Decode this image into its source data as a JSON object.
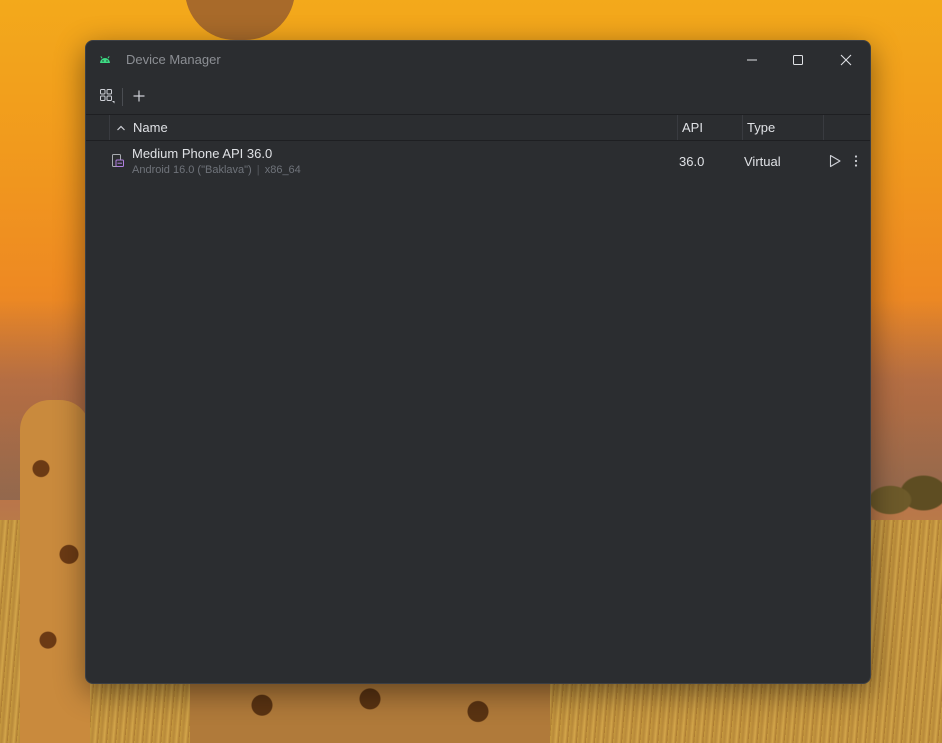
{
  "window": {
    "title": "Device Manager"
  },
  "icons": {
    "app": "android-icon",
    "minimize": "minimize-icon",
    "maximize": "maximize-icon",
    "close": "close-icon",
    "group": "group-devices-icon",
    "add": "plus-icon",
    "sort": "chevron-up-icon",
    "device": "phone-device-icon",
    "play": "play-icon",
    "more": "more-vertical-icon"
  },
  "colors": {
    "window_bg": "#2b2d30",
    "text": "#dfe1e5",
    "muted": "#6f737a",
    "android_green": "#3ddc84",
    "device_purple": "#b07fe0"
  },
  "table": {
    "columns": {
      "name": "Name",
      "api": "API",
      "type": "Type"
    },
    "sort": {
      "column": "Name",
      "direction": "ascending"
    },
    "rows": [
      {
        "name": "Medium Phone API 36.0",
        "android_version": "Android 16.0 (\"Baklava\")",
        "separator": "|",
        "abi": "x86_64",
        "api": "36.0",
        "type": "Virtual"
      }
    ]
  }
}
